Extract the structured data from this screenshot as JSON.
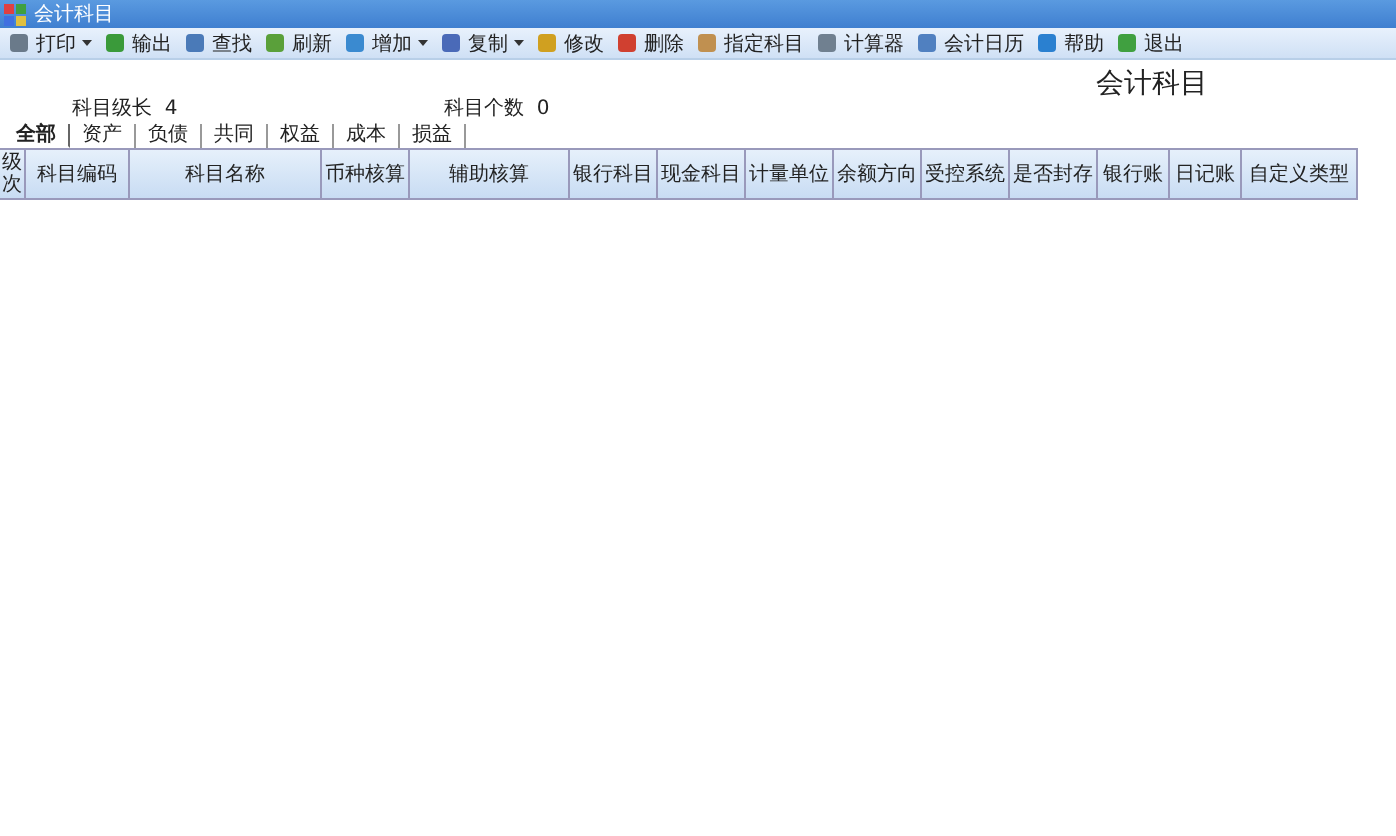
{
  "window": {
    "title": "会计科目"
  },
  "toolbar": [
    {
      "label": "打印",
      "kind": "dropdown"
    },
    {
      "label": "输出",
      "kind": "button"
    },
    {
      "label": "查找",
      "kind": "button"
    },
    {
      "label": "刷新",
      "kind": "button"
    },
    {
      "label": "增加",
      "kind": "dropdown"
    },
    {
      "label": "复制",
      "kind": "dropdown"
    },
    {
      "label": "修改",
      "kind": "button"
    },
    {
      "label": "删除",
      "kind": "button"
    },
    {
      "label": "指定科目",
      "kind": "button"
    },
    {
      "label": "计算器",
      "kind": "button"
    },
    {
      "label": "会计日历",
      "kind": "button"
    },
    {
      "label": "帮助",
      "kind": "button"
    },
    {
      "label": "退出",
      "kind": "button"
    }
  ],
  "heading": "会计科目",
  "info": [
    {
      "label": "科目级长",
      "value": "4"
    },
    {
      "label": "科目个数",
      "value": "0"
    }
  ],
  "tabs": [
    {
      "label": "全部",
      "selected": true
    },
    {
      "label": "资产",
      "selected": false
    },
    {
      "label": "负债",
      "selected": false
    },
    {
      "label": "共同",
      "selected": false
    },
    {
      "label": "权益",
      "selected": false
    },
    {
      "label": "成本",
      "selected": false
    },
    {
      "label": "损益",
      "selected": false
    }
  ],
  "table": {
    "columns": [
      "级次",
      "科目编码",
      "科目名称",
      "币种核算",
      "辅助核算",
      "银行科目",
      "现金科目",
      "计量单位",
      "余额方向",
      "受控系统",
      "是否封存",
      "银行账",
      "日记账",
      "自定义类型"
    ]
  }
}
